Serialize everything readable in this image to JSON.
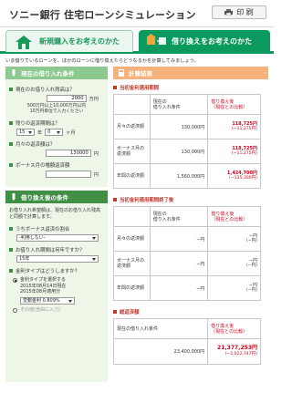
{
  "header": {
    "title": "ソニー銀行 住宅ローンシミュレーション",
    "print_label": "印 刷"
  },
  "tabs": [
    {
      "label": "新規購入をお考えのかた",
      "active": false
    },
    {
      "label": "借り換えをお考えのかた",
      "active": true
    }
  ],
  "intro": "いま借りているローンを、ほかのローンに借り換えたらどうなるかを計算してみましょう。",
  "left": {
    "current": {
      "title": "現在の借り入れ条件",
      "loan_label": "現在のお借り入れ残高は？",
      "loan_value": "2000",
      "loan_unit": "万円",
      "loan_hint": "500万円以上10,000万円以内\n10万円単位で入力ください",
      "term_label": "残りの返済期間は？",
      "term_years": "15",
      "term_years_unit": "年",
      "term_months": "0",
      "term_months_unit": "ヶ月",
      "monthly_label": "月々の返済額は？",
      "monthly_value": "130000",
      "monthly_unit": "円",
      "bonus_label": "ボーナス月の増額返済額",
      "bonus_value": "",
      "bonus_unit": "円"
    },
    "after": {
      "title": "借り換え後の条件",
      "desc": "お借り入れ希望額は、現在のお借り入れ残高と同額で計算します。",
      "bonus_ratio_label": "うちボーナス返済の割合",
      "bonus_ratio_value": "-利用しない-",
      "period_label": "お借り入れ期間は何年ですか？",
      "period_value": "15年",
      "rate_label": "金利タイプはどうしますか？",
      "rate_option1": "金利タイプを選択する\n2015年08月14日現在\n2015年08月適用分",
      "rate_select_value": "変動金利 0.809%",
      "rate_option2": "その他(自由に入力)"
    }
  },
  "results": {
    "title": "計算結果",
    "tables": [
      {
        "title": "当初金利適用期間",
        "col1": "現在の\n借り入れ条件",
        "col2": "借り換え後\n（現在との比較）",
        "rows": [
          {
            "name": "月々の返済額",
            "current": "130,000円",
            "new": "118,725円",
            "diff": "(−11,275円)"
          },
          {
            "name": "ボーナス月の\n返済額",
            "current": "130,000円",
            "new": "118,725円",
            "diff": "(−11,275円)"
          },
          {
            "name": "年間の返済額",
            "current": "1,560,000円",
            "new": "1,424,700円",
            "diff": "(−135,300円)"
          }
        ]
      },
      {
        "title": "当初金利適用期間終了後",
        "col1": "現在の\n借り入れ条件",
        "col2": "借り換え後\n（現在との比較）",
        "rows": [
          {
            "name": "月々の返済額",
            "current": "−円",
            "new": "−円",
            "diff": "(−円)"
          },
          {
            "name": "ボーナス月の\n返済額",
            "current": "−円",
            "new": "−円",
            "diff": "(−円)"
          },
          {
            "name": "年間の返済額",
            "current": "−円",
            "new": "−円",
            "diff": "(−円)"
          }
        ]
      },
      {
        "title": "総返済額",
        "col1": "現在の借り入れ条件",
        "col2": "借り換え後\n（現在との比較）",
        "rows": [
          {
            "name": "",
            "current": "23,400,000円",
            "new": "21,377,253円",
            "diff": "(−2,022,747円)"
          }
        ]
      }
    ]
  },
  "colors": {
    "brand_green": "#0a9a5e",
    "result_orange": "#f6b27c",
    "accent_red": "#d6001c",
    "panel_green": "#8dc88f"
  }
}
